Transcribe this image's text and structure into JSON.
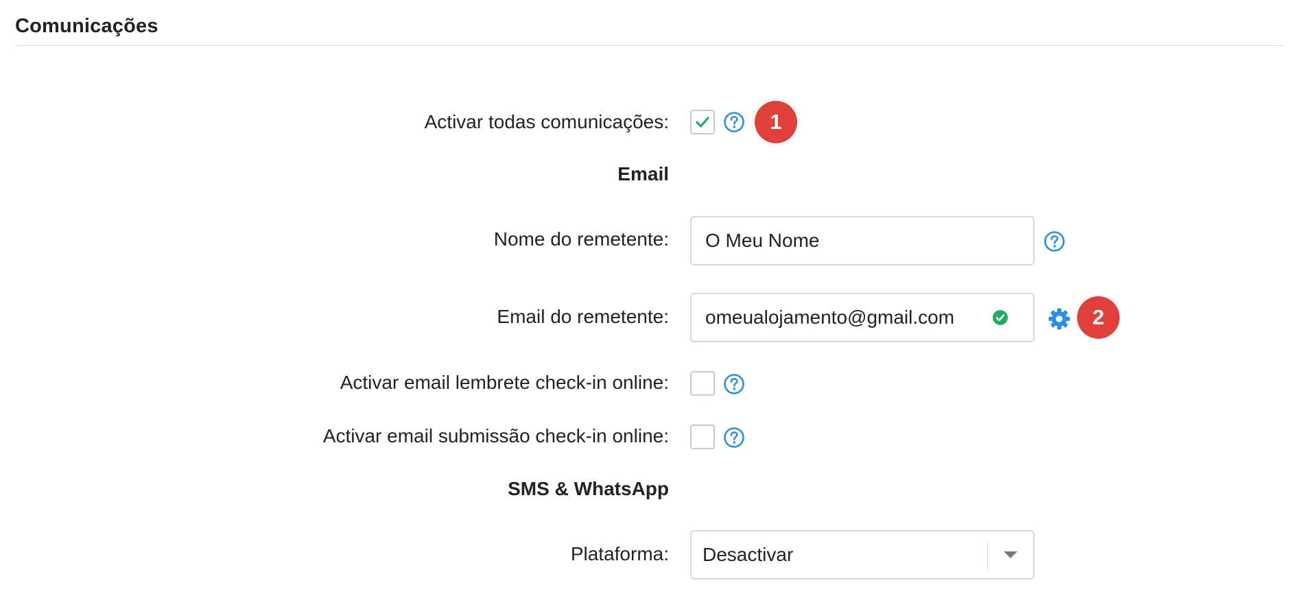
{
  "section": {
    "title": "Comunicações"
  },
  "fields": {
    "activate_all": {
      "label": "Activar todas comunicações:",
      "checked": true
    },
    "email_heading": "Email",
    "sender_name": {
      "label": "Nome do remetente:",
      "value": "O Meu Nome"
    },
    "sender_email": {
      "label": "Email do remetente:",
      "value": "omeualojamento@gmail.com",
      "status": "verified"
    },
    "reminder_checkin": {
      "label": "Activar email lembrete check-in online:",
      "checked": false
    },
    "submission_checkin": {
      "label": "Activar email submissão check-in online:",
      "checked": false
    },
    "sms_heading": "SMS & WhatsApp",
    "platform": {
      "label": "Plataforma:",
      "selected": "Desactivar"
    }
  },
  "badges": {
    "first": "1",
    "second": "2"
  },
  "colors": {
    "accent_blue": "#2a8fe0",
    "check_green": "#1fae64",
    "badge_red": "#e0403a"
  },
  "icons": {
    "help": "question-circle-icon",
    "settings": "gear-icon",
    "verified": "check-circle-icon",
    "dropdown": "caret-down-icon"
  }
}
